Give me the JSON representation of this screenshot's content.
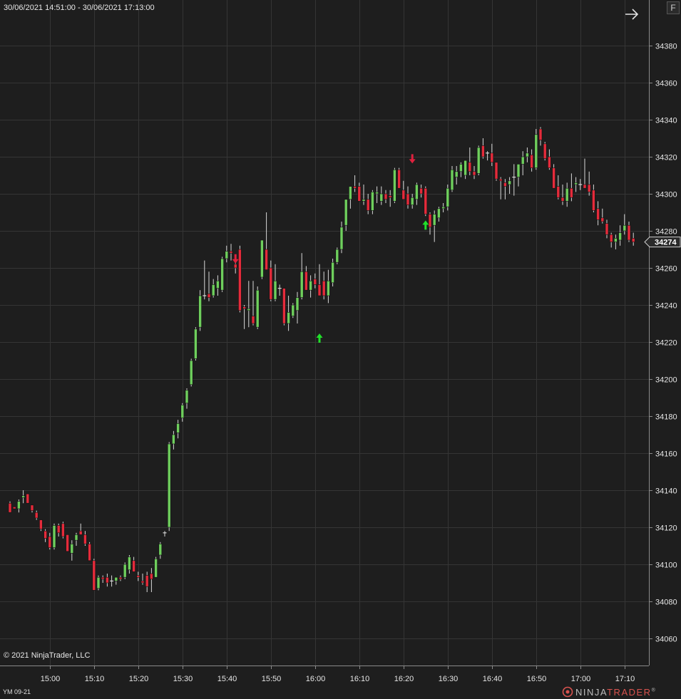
{
  "header": {
    "date_range": "30/06/2021 14:51:00 - 30/06/2021 17:13:00"
  },
  "footer": {
    "copyright": "© 2021 NinjaTrader, LLC",
    "instrument": "YM 09-21",
    "brand_ninja": "NINJA",
    "brand_trader": "TRADER",
    "brand_reg": "®"
  },
  "controls": {
    "f_button": "F",
    "arrow_icon": "arrow-right-icon"
  },
  "colors": {
    "background": "#1e1e1e",
    "grid": "#353535",
    "up": "#6fcf5d",
    "down": "#e52b3b",
    "wick": "#d8d8d8",
    "text": "#e6e6e6",
    "buy_signal": "#21e02a",
    "sell_signal": "#e0213e"
  },
  "chart_data": {
    "type": "candlestick",
    "instrument": "YM 09-21",
    "interval_minutes": 1,
    "y_axis": {
      "min": 34050,
      "max": 34400,
      "ticks": [
        34060,
        34080,
        34100,
        34120,
        34140,
        34160,
        34180,
        34200,
        34220,
        34240,
        34260,
        34280,
        34300,
        34320,
        34340,
        34360,
        34380
      ]
    },
    "x_axis": {
      "tick_labels": [
        "15:00",
        "15:10",
        "15:20",
        "15:30",
        "15:40",
        "15:50",
        "16:00",
        "16:10",
        "16:20",
        "16:30",
        "16:40",
        "16:50",
        "17:00",
        "17:10"
      ],
      "first_tick_index": 9,
      "tick_every": 10
    },
    "last_price": 34274,
    "candles": [
      [
        34133,
        34134,
        34128,
        34128
      ],
      [
        34131,
        34131,
        34130,
        34130
      ],
      [
        34130,
        34135,
        34128,
        34134
      ],
      [
        34136,
        34140,
        34133,
        34137
      ],
      [
        34138,
        34138,
        34133,
        34133
      ],
      [
        34132,
        34132,
        34128,
        34129
      ],
      [
        34128,
        34129,
        34124,
        34125
      ],
      [
        34124,
        34124,
        34118,
        34119
      ],
      [
        34118,
        34119,
        34112,
        34114
      ],
      [
        34115,
        34117,
        34108,
        34109
      ],
      [
        34109,
        34122,
        34108,
        34121
      ],
      [
        34121,
        34122,
        34115,
        34117
      ],
      [
        34122,
        34123,
        34114,
        34115
      ],
      [
        34116,
        34116,
        34107,
        34107
      ],
      [
        34106,
        34113,
        34102,
        34111
      ],
      [
        34113,
        34117,
        34110,
        34116
      ],
      [
        34118,
        34122,
        34116,
        34116
      ],
      [
        34116,
        34118,
        34110,
        34111
      ],
      [
        34111,
        34112,
        34102,
        34102
      ],
      [
        34102,
        34103,
        34086,
        34086
      ],
      [
        34087,
        34094,
        34086,
        34093
      ],
      [
        34093,
        34094,
        34090,
        34092
      ],
      [
        34093,
        34095,
        34088,
        34090
      ],
      [
        34091,
        34094,
        34088,
        34091
      ],
      [
        34091,
        34093,
        34089,
        34093
      ],
      [
        34093,
        34094,
        34091,
        34092
      ],
      [
        34093,
        34101,
        34092,
        34100
      ],
      [
        34097,
        34105,
        34095,
        34104
      ],
      [
        34102,
        34104,
        34096,
        34096
      ],
      [
        34094,
        34096,
        34091,
        34093
      ],
      [
        34091,
        34095,
        34089,
        34090
      ],
      [
        34094,
        34096,
        34085,
        34088
      ],
      [
        34095,
        34098,
        34085,
        34092
      ],
      [
        34093,
        34104,
        34093,
        34103
      ],
      [
        34105,
        34112,
        34103,
        34111
      ],
      [
        34117,
        34118,
        34115,
        34117
      ],
      [
        34120,
        34166,
        34118,
        34165
      ],
      [
        34165,
        34172,
        34162,
        34170
      ],
      [
        34171,
        34178,
        34168,
        34176
      ],
      [
        34179,
        34187,
        34177,
        34186
      ],
      [
        34187,
        34195,
        34184,
        34194
      ],
      [
        34197,
        34211,
        34196,
        34210
      ],
      [
        34211,
        34228,
        34210,
        34227
      ],
      [
        34228,
        34248,
        34226,
        34245
      ],
      [
        34245,
        34264,
        34243,
        34245
      ],
      [
        34246,
        34258,
        34242,
        34244
      ],
      [
        34245,
        34254,
        34244,
        34251
      ],
      [
        34249,
        34256,
        34245,
        34253
      ],
      [
        34248,
        34266,
        34247,
        34265
      ],
      [
        34265,
        34272,
        34263,
        34269
      ],
      [
        34269,
        34273,
        34264,
        34268
      ],
      [
        34262,
        34266,
        34257,
        34260
      ],
      [
        34270,
        34272,
        34236,
        34237
      ],
      [
        34239,
        34240,
        34227,
        34238
      ],
      [
        34237,
        34253,
        34228,
        34238
      ],
      [
        34234,
        34253,
        34229,
        34230
      ],
      [
        34228,
        34250,
        34227,
        34248
      ],
      [
        34255,
        34275,
        34254,
        34275
      ],
      [
        34270,
        34290,
        34268,
        34259
      ],
      [
        34260,
        34264,
        34242,
        34243
      ],
      [
        34243,
        34262,
        34242,
        34253
      ],
      [
        34249,
        34251,
        34245,
        34249
      ],
      [
        34249,
        34249,
        34229,
        34230
      ],
      [
        34230,
        34245,
        34226,
        34236
      ],
      [
        34234,
        34241,
        34233,
        34240
      ],
      [
        34237,
        34247,
        34230,
        34244
      ],
      [
        34244,
        34268,
        34243,
        34258
      ],
      [
        34258,
        34261,
        34248,
        34248
      ],
      [
        34248,
        34256,
        34244,
        34253
      ],
      [
        34254,
        34257,
        34249,
        34251
      ],
      [
        34251,
        34262,
        34247,
        34245
      ],
      [
        34253,
        34258,
        34243,
        34245
      ],
      [
        34245,
        34259,
        34241,
        34253
      ],
      [
        34252,
        34265,
        34250,
        34263
      ],
      [
        34263,
        34271,
        34262,
        34270
      ],
      [
        34270,
        34285,
        34268,
        34282
      ],
      [
        34283,
        34297,
        34280,
        34297
      ],
      [
        34297,
        34304,
        34292,
        34304
      ],
      [
        34304,
        34310,
        34301,
        34303
      ],
      [
        34304,
        34306,
        34296,
        34296
      ],
      [
        34296,
        34305,
        34294,
        34297
      ],
      [
        34297,
        34300,
        34289,
        34291
      ],
      [
        34291,
        34302,
        34289,
        34301
      ],
      [
        34300,
        34304,
        34295,
        34301
      ],
      [
        34296,
        34304,
        34294,
        34300
      ],
      [
        34300,
        34302,
        34295,
        34297
      ],
      [
        34299,
        34302,
        34293,
        34298
      ],
      [
        34296,
        34314,
        34295,
        34313
      ],
      [
        34313,
        34314,
        34303,
        34303
      ],
      [
        34302,
        34307,
        34297,
        34297
      ],
      [
        34300,
        34304,
        34292,
        34294
      ],
      [
        34294,
        34300,
        34292,
        34298
      ],
      [
        34297,
        34306,
        34294,
        34305
      ],
      [
        34303,
        34305,
        34298,
        34300
      ],
      [
        34303,
        34304,
        34288,
        34289
      ],
      [
        34289,
        34290,
        34278,
        34282
      ],
      [
        34283,
        34291,
        34274,
        34289
      ],
      [
        34287,
        34293,
        34285,
        34292
      ],
      [
        34292,
        34295,
        34290,
        34293
      ],
      [
        34293,
        34305,
        34291,
        34303
      ],
      [
        34302,
        34315,
        34301,
        34313
      ],
      [
        34309,
        34315,
        34305,
        34312
      ],
      [
        34312,
        34317,
        34309,
        34316
      ],
      [
        34310,
        34318,
        34308,
        34318
      ],
      [
        34317,
        34325,
        34310,
        34312
      ],
      [
        34312,
        34315,
        34308,
        34310
      ],
      [
        34311,
        34326,
        34310,
        34325
      ],
      [
        34326,
        34330,
        34319,
        34320
      ],
      [
        34322,
        34323,
        34318,
        34322
      ],
      [
        34322,
        34327,
        34315,
        34317
      ],
      [
        34317,
        34317,
        34307,
        34308
      ],
      [
        34308,
        34309,
        34297,
        34307
      ],
      [
        34306,
        34308,
        34297,
        34304
      ],
      [
        34305,
        34309,
        34300,
        34307
      ],
      [
        34309,
        34316,
        34299,
        34309
      ],
      [
        34309,
        34316,
        34304,
        34316
      ],
      [
        34316,
        34323,
        34310,
        34320
      ],
      [
        34320,
        34325,
        34317,
        34322
      ],
      [
        34321,
        34324,
        34312,
        34314
      ],
      [
        34314,
        34335,
        34313,
        34332
      ],
      [
        34335,
        34336,
        34326,
        34329
      ],
      [
        34327,
        34328,
        34318,
        34319
      ],
      [
        34320,
        34324,
        34313,
        34314
      ],
      [
        34314,
        34316,
        34303,
        34303
      ],
      [
        34304,
        34310,
        34297,
        34298
      ],
      [
        34298,
        34305,
        34294,
        34296
      ],
      [
        34296,
        34306,
        34293,
        34303
      ],
      [
        34303,
        34311,
        34296,
        34298
      ],
      [
        34305,
        34309,
        34301,
        34306
      ],
      [
        34305,
        34308,
        34302,
        34305
      ],
      [
        34305,
        34319,
        34303,
        34303
      ],
      [
        34305,
        34312,
        34299,
        34301
      ],
      [
        34302,
        34305,
        34290,
        34291
      ],
      [
        34292,
        34296,
        34283,
        34286
      ],
      [
        34287,
        34292,
        34284,
        34285
      ],
      [
        34284,
        34286,
        34276,
        34278
      ],
      [
        34278,
        34279,
        34271,
        34274
      ],
      [
        34274,
        34278,
        34270,
        34276
      ],
      [
        34275,
        34283,
        34272,
        34279
      ],
      [
        34280,
        34289,
        34278,
        34283
      ],
      [
        34283,
        34285,
        34274,
        34275
      ],
      [
        34276,
        34279,
        34272,
        34274
      ]
    ],
    "signals": [
      {
        "bar": 51,
        "type": "sell",
        "price": 34262
      },
      {
        "bar": 70,
        "type": "buy",
        "price": 34225
      },
      {
        "bar": 91,
        "type": "sell",
        "price": 34316
      },
      {
        "bar": 94,
        "type": "buy",
        "price": 34286
      }
    ]
  }
}
